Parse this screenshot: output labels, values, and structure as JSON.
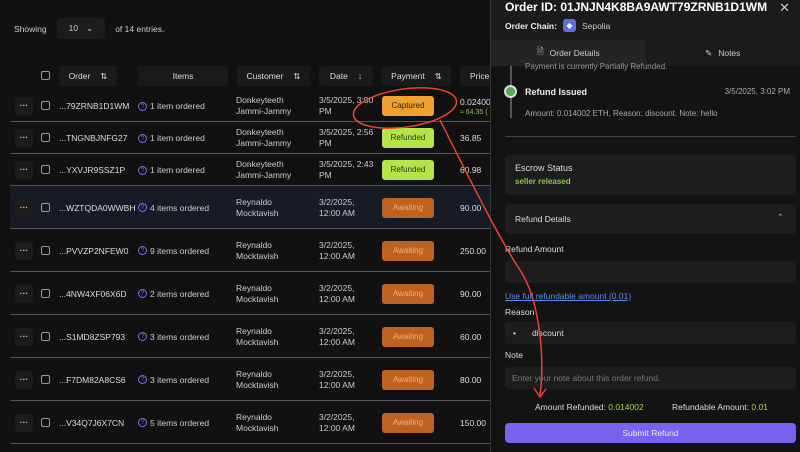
{
  "toolbar": {
    "showing": "Showing",
    "page_size": "10",
    "of_entries": "of 14 entries."
  },
  "columns": [
    "Order",
    "Items",
    "Customer",
    "Date",
    "Payment",
    "Price"
  ],
  "rows": [
    {
      "order": "...79ZRNB1D1WM",
      "items": "1 item ordered",
      "cust1": "Donkeyteeth",
      "cust2": "Jammi-Jammy",
      "date1": "3/5/2025, 3:00",
      "date2": "PM",
      "payment": "Captured",
      "price": "0.02400",
      "price2": "≈ 64.35 ("
    },
    {
      "order": "...TNGNBJNFG27",
      "items": "1 item ordered",
      "cust1": "Donkeyteeth",
      "cust2": "Jammi-Jammy",
      "date1": "3/5/2025, 2:56",
      "date2": "PM",
      "payment": "Refunded",
      "price": "36.85"
    },
    {
      "order": "...YXVJR9SSZ1P",
      "items": "1 item ordered",
      "cust1": "Donkeyteeth",
      "cust2": "Jammi-Jammy",
      "date1": "3/5/2025, 2:43",
      "date2": "PM",
      "payment": "Refunded",
      "price": "60.98"
    },
    {
      "order": "...WZTQDA0WWBH",
      "items": "4 items ordered",
      "cust1": "Reynaldo",
      "cust2": "Mocktavish",
      "date1": "3/2/2025,",
      "date2": "12:00 AM",
      "payment": "Awaiting",
      "price": "90.00"
    },
    {
      "order": "...PVVZP2NFEW0",
      "items": "9 items ordered",
      "cust1": "Reynaldo",
      "cust2": "Mocktavish",
      "date1": "3/2/2025,",
      "date2": "12:00 AM",
      "payment": "Awaiting",
      "price": "250.00"
    },
    {
      "order": "...4NW4XF06X6D",
      "items": "2 items ordered",
      "cust1": "Reynaldo",
      "cust2": "Mocktavish",
      "date1": "3/2/2025,",
      "date2": "12:00 AM",
      "payment": "Awaiting",
      "price": "90.00"
    },
    {
      "order": "...S1MD8ZSP793",
      "items": "3 items ordered",
      "cust1": "Reynaldo",
      "cust2": "Mocktavish",
      "date1": "3/2/2025,",
      "date2": "12:00 AM",
      "payment": "Awaiting",
      "price": "60.00"
    },
    {
      "order": "...F7DM82A8CS6",
      "items": "3 items ordered",
      "cust1": "Reynaldo",
      "cust2": "Mocktavish",
      "date1": "3/2/2025,",
      "date2": "12:00 AM",
      "payment": "Awaiting",
      "price": "80.00"
    },
    {
      "order": "...V34Q7J6X7CN",
      "items": "5 items ordered",
      "cust1": "Reynaldo",
      "cust2": "Mocktavish",
      "date1": "3/2/2025,",
      "date2": "12:00 AM",
      "payment": "Awaiting",
      "price": "150.00"
    }
  ],
  "badge_colors": {
    "Captured": "#f0a030",
    "Refunded": "#b5e34a",
    "Awaiting": "#c0621f"
  },
  "panel": {
    "order_id": "Order ID: 01JNJN4K8BA9AWT79ZRNB1D1WM",
    "chain_label": "Order Chain:",
    "chain": "Sepolia",
    "tabs": [
      "Order Details",
      "Notes"
    ],
    "prev_event": "Payment is currently Partially Refunded.",
    "event_title": "Refund Issued",
    "event_time": "3/5/2025, 3:02 PM",
    "event_desc": "Amount: 0.014002 ETH, Reason: discount. Note: hello",
    "escrow_label": "Escrow Status",
    "escrow_value": "seller released",
    "refund_details": "Refund Details",
    "refund_amount_label": "Refund Amount",
    "use_full": "Use full refundable amount (0.01)",
    "reason_label": "Reason",
    "reason_value": "discount",
    "note_label": "Note",
    "note_placeholder": "Enter your note about this order refund.",
    "amount_refunded_label": "Amount Refunded:",
    "amount_refunded": "0.014002",
    "refundable_label": "Refundable Amount:",
    "refundable": "0.01",
    "submit": "Submit Refund"
  }
}
